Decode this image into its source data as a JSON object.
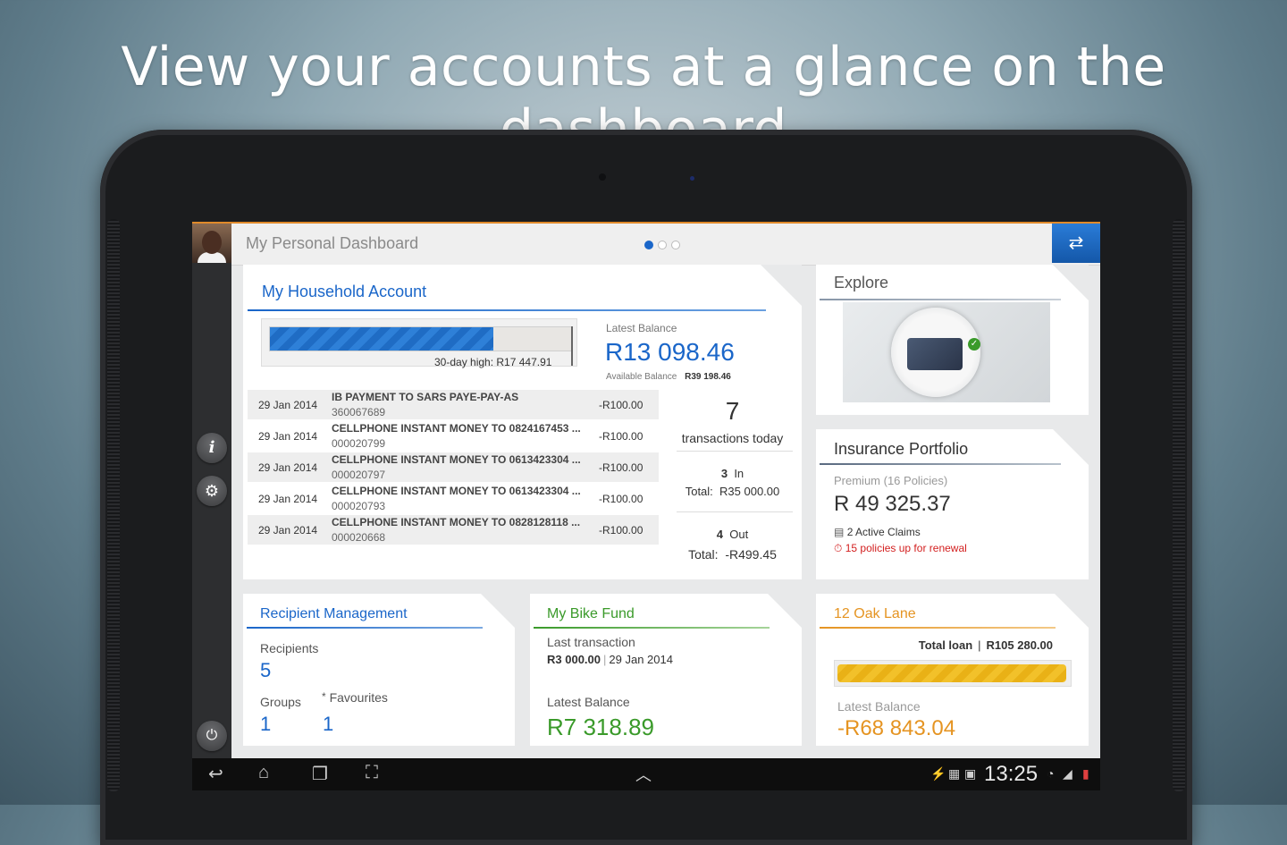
{
  "headline": "View your accounts at a glance on the dashboard",
  "header": {
    "title": "My Personal Dashboard",
    "page_dots": 3,
    "active_dot": 0,
    "switch_icon": "swap-arrows-icon"
  },
  "household": {
    "title": "My Household Account",
    "progress_fraction": 0.74,
    "high_label": "30-day high:",
    "high_value": "R17 447.91",
    "latest_balance_label": "Latest Balance",
    "latest_balance": "R13 098.46",
    "available_label": "Available Balance",
    "available_value": "R39 198.46",
    "transactions": [
      {
        "date": "29 Jan 2014",
        "desc": "IB PAYMENT TO SARS PAYE-PAY-AS",
        "ref": "360067689",
        "amount": "-R100.00"
      },
      {
        "date": "29 Jan 2014",
        "desc": "CELLPHONE INSTANT MONEY TO 0824167453 ...",
        "ref": "000020799",
        "amount": "-R100.00"
      },
      {
        "date": "29 Jan 2014",
        "desc": "CELLPHONE INSTANT MONEY TO 0613423304 ...",
        "ref": "000020797",
        "amount": "-R100.00"
      },
      {
        "date": "29 Jan 2014",
        "desc": "CELLPHONE INSTANT MONEY TO 0613423304 ...",
        "ref": "000020793",
        "amount": "-R100.00"
      },
      {
        "date": "29 Jan 2014",
        "desc": "CELLPHONE INSTANT MONEY TO 0828128118 ...",
        "ref": "000020668",
        "amount": "-R100.00"
      }
    ],
    "summary": {
      "count": "7",
      "count_label": "transactions today",
      "in_count": "3",
      "in_label": "In",
      "in_total_label": "Total:",
      "in_total": "R35 000.00",
      "out_count": "4",
      "out_label": "Out",
      "out_total_label": "Total:",
      "out_total": "-R499.45"
    }
  },
  "explore": {
    "title": "Explore"
  },
  "insurance": {
    "title": "Insurance Portfolio",
    "premium_label": "Premium (16 Policies)",
    "premium_value": "R 49 325.37",
    "claims": "2 Active Claims",
    "renewal": "15 policies up for renewal"
  },
  "recipients": {
    "title": "Recipient Management",
    "recipients_label": "Recipients",
    "recipients_count": "5",
    "groups_label": "Groups",
    "groups_count": "1",
    "favourites_label": "Favourites",
    "favourites_count": "1"
  },
  "bike": {
    "title": "My Bike Fund",
    "last_tx_label": "Last transaction",
    "last_tx_amount": "R3 000.00",
    "last_tx_date": "29 Jan 2014",
    "latest_label": "Latest Balance",
    "latest_value": "R7 318.89"
  },
  "oak": {
    "title": "12 Oak Lane",
    "total_loan_label": "Total loan",
    "total_loan_value": "R105 280.00",
    "progress_fraction": 1.0,
    "latest_label": "Latest Balance",
    "latest_value": "-R68 843.04"
  },
  "statusbar": {
    "time": "13:25"
  },
  "colors": {
    "blue": "#1a66c9",
    "green": "#3a9a2a",
    "orange": "#e59422",
    "red": "#d32020"
  }
}
